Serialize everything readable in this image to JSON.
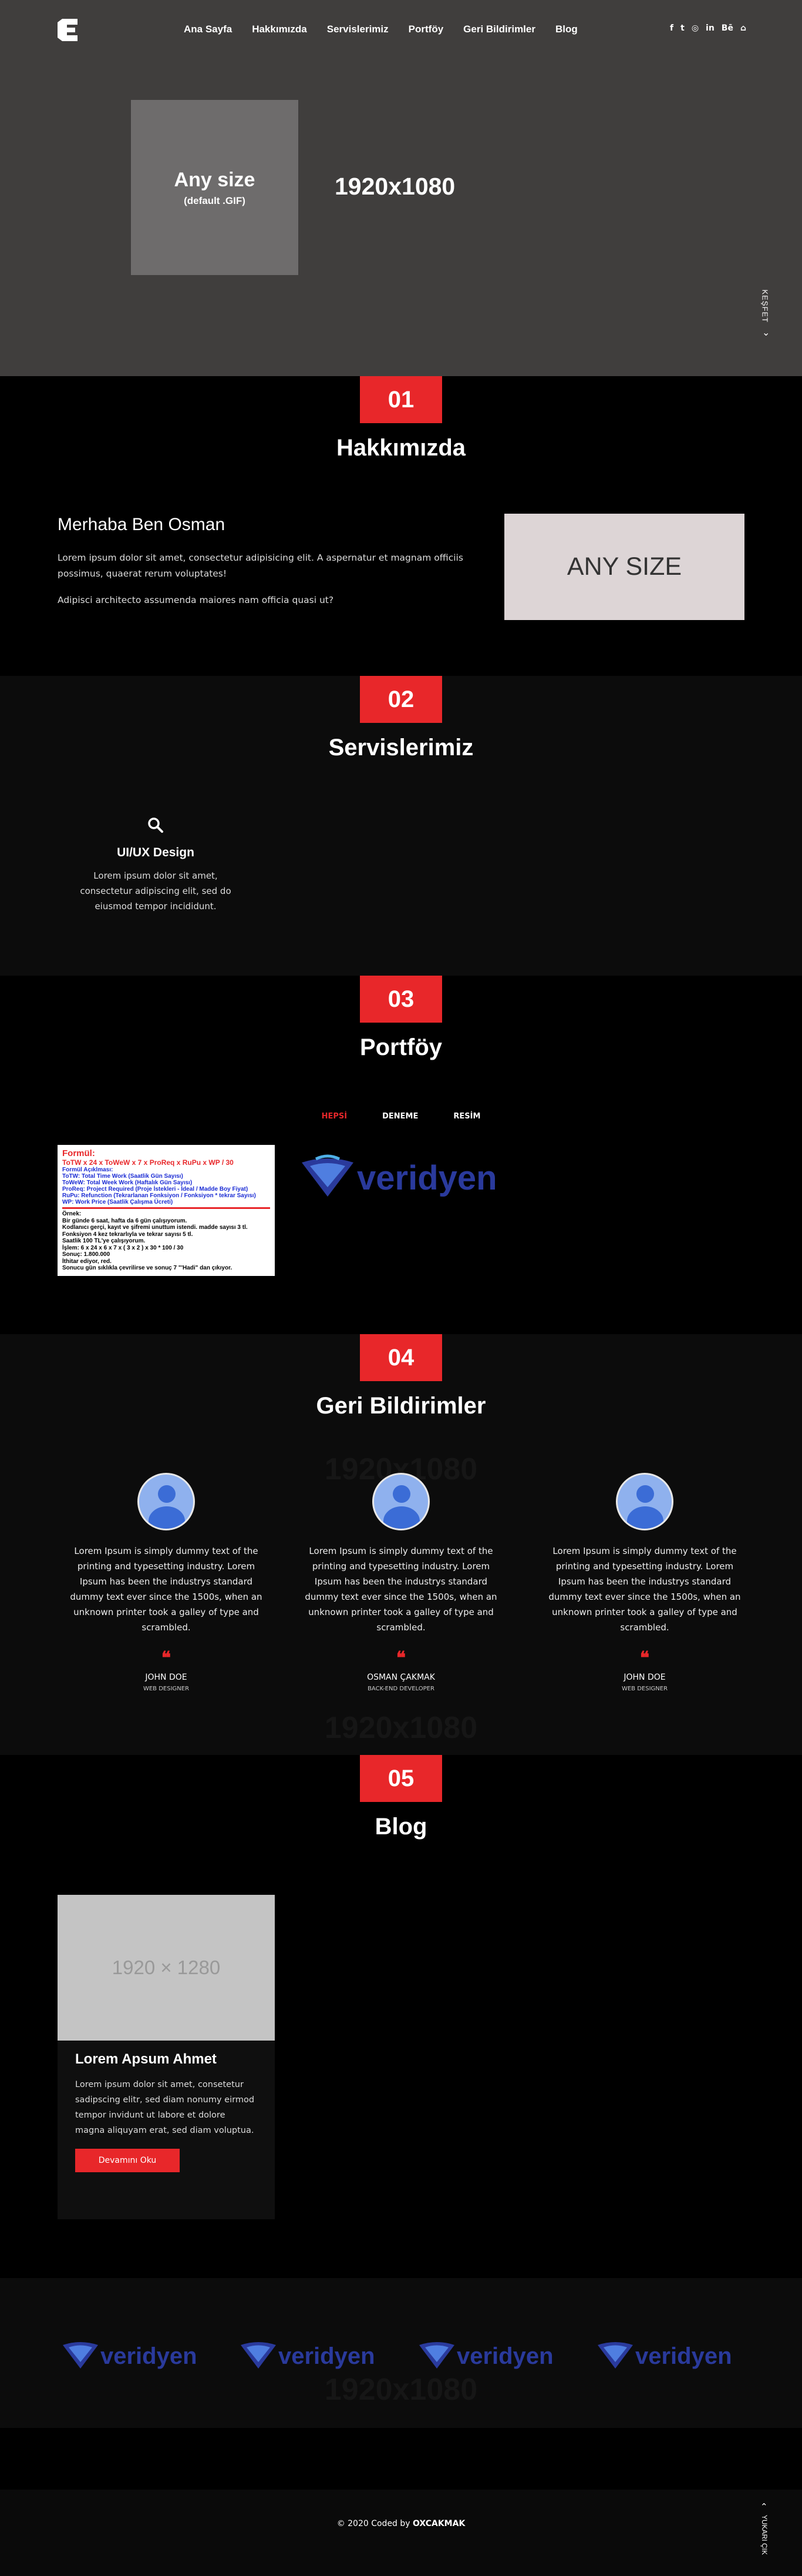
{
  "nav": {
    "items": [
      "Ana Sayfa",
      "Hakkımızda",
      "Servislerimiz",
      "Portföy",
      "Geri Bildirimler",
      "Blog"
    ],
    "social_icons": [
      "facebook-icon",
      "twitter-icon",
      "instagram-icon",
      "linkedin-icon",
      "behance-icon",
      "github-icon"
    ],
    "social_glyphs": [
      "f",
      "t",
      "◎",
      "in",
      "Bē",
      "⌂"
    ]
  },
  "hero": {
    "gif_title": "Any size",
    "gif_sub": "(default .GIF)",
    "resolution": "1920x1080",
    "discover": "KEŞFET"
  },
  "about": {
    "number": "01",
    "title": "Hakkımızda",
    "heading": "Merhaba Ben Osman",
    "p1": "Lorem ipsum dolor sit amet, consectetur adipisicing elit. A aspernatur et magnam officiis possimus, quaerat rerum voluptates!",
    "p2": "Adipisci architecto assumenda maiores nam officia quasi ut?",
    "image_text": "ANY SIZE"
  },
  "services": {
    "number": "02",
    "title": "Servislerimiz",
    "item_title": "UI/UX Design",
    "item_icon": "search-icon",
    "item_desc": "Lorem ipsum dolor sit amet, consectetur adipiscing elit, sed do eiusmod tempor incididunt."
  },
  "portfolio": {
    "number": "03",
    "title": "Portföy",
    "filters": [
      "HEPSİ",
      "DENEME",
      "RESİM"
    ],
    "active_filter": "HEPSİ",
    "card1": {
      "l1": "Formül:",
      "l2": "ToTW x 24 x ToWeW x 7 x ProReq x RuPu x WP / 30",
      "blue": [
        "Formül Açıklması:",
        "ToTW: Total Time Work (Saatlik Gün Sayısı)",
        "ToWeW: Total Week Work (Haftalık Gün Sayısı)",
        "ProReq: Project Required (Proje İstekleri - İdeal / Madde Boy Fiyat)",
        "RuPu: Refunction (Tekrarlanan Fonksiyon / Fonksiyon * tekrar Sayısı)",
        "WP: Work Price (Saatlik Çalışma Ücreti)"
      ],
      "black": [
        "Örnek:",
        "Bir günde 6 saat, hafta da 6 gün çalışıyorum.",
        "Kodlanıcı gerçi, kayıt ve şifremi unuttum istendi. madde sayısı 3 tl.",
        "Fonksiyon 4 kez tekrarlıyla ve tekrar sayısı 5 tl.",
        "Saatlik 100 TL'ye çalışıyorum.",
        "İşlem: 6 x 24 x 6 x 7 x ( 3 x 2 ) x 30 * 100 / 30",
        "Sonuç: 1.800.000",
        "İthitar ediyor, red.",
        "Sonucu gün sıklıkla çevrilirse ve sonuç 7 \"'Hadi\" dan çıkıyor."
      ]
    },
    "card2_text": "veridyen"
  },
  "testimonials": {
    "number": "04",
    "title": "Geri Bildirimler",
    "ghost": "1920x1080",
    "quote": "Lorem Ipsum is simply dummy text of the printing and typesetting industry. Lorem Ipsum has been the industrys standard dummy text ever since the 1500s, when an unknown printer took a galley of type and scrambled.",
    "quote_mark": "❝",
    "people": [
      {
        "name": "JOHN DOE",
        "role": "WEB DESIGNER"
      },
      {
        "name": "OSMAN ÇAKMAK",
        "role": "BACK-END DEVELOPER"
      },
      {
        "name": "JOHN DOE",
        "role": "WEB DESIGNER"
      }
    ]
  },
  "blog": {
    "number": "05",
    "title": "Blog",
    "image_text": "1920 × 1280",
    "post_title": "Lorem Apsum Ahmet",
    "post_body": "Lorem ipsum dolor sit amet, consetetur sadipscing elitr, sed diam nonumy eirmod tempor invidunt ut labore et dolore magna aliquyam erat, sed diam voluptua.",
    "button": "Devamını Oku"
  },
  "clients": {
    "logo_text": "veridyen",
    "ghost": "1920x1080"
  },
  "footer": {
    "copy_prefix": "© 2020 Coded by ",
    "copy_author": "OXCAKMAK",
    "up": "YUKARI ÇIK"
  },
  "colors": {
    "accent": "#e8272a",
    "hero_bg": "#403e3d",
    "logo_blue": "#2a3a9c"
  }
}
